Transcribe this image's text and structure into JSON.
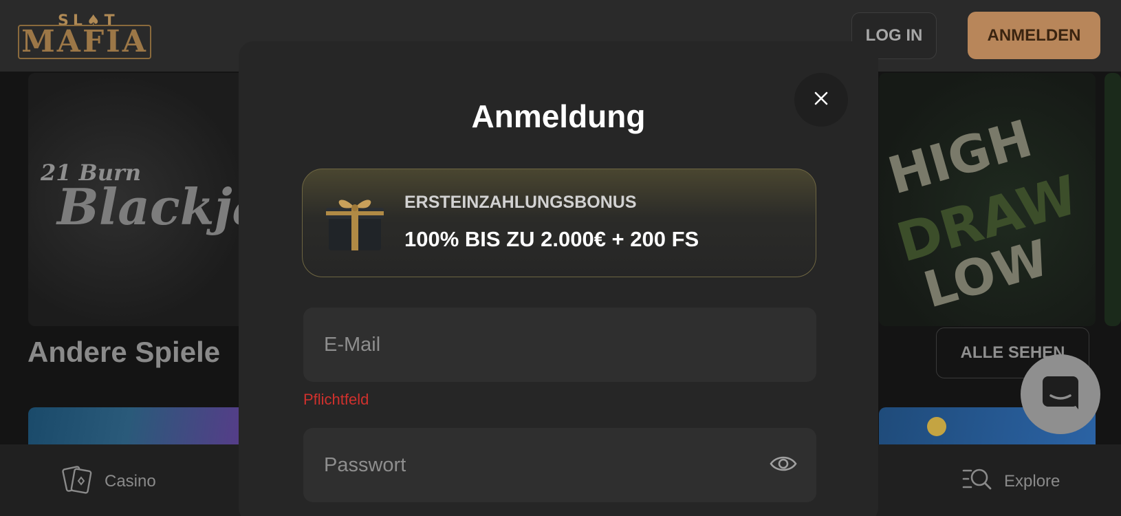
{
  "header": {
    "logo_small": "SL♠T",
    "logo_big": "MAFIA",
    "login_label": "LOG IN",
    "register_label": "ANMELDEN"
  },
  "background": {
    "tile_blackjack_line1": "21 Burn",
    "tile_blackjack_line2": "Blackjack",
    "tile_hilo_word1": "HIGH",
    "tile_hilo_word2": "DRAW",
    "tile_hilo_word3": "LOW",
    "section_title": "Andere Spiele",
    "see_all_label": "ALLE SEHEN"
  },
  "bottom_nav": {
    "casino_label": "Casino",
    "explore_label": "Explore"
  },
  "modal": {
    "title": "Anmeldung",
    "bonus": {
      "label": "ERSTEINZAHLUNGSBONUS",
      "value": "100% BIS ZU 2.000€ + 200 FS"
    },
    "email": {
      "placeholder": "E-Mail",
      "value": "",
      "error": "Pflichtfeld"
    },
    "password": {
      "placeholder": "Passwort",
      "value": ""
    }
  },
  "icons": {
    "close": "close-icon",
    "eye": "eye-icon",
    "gift": "gift-icon",
    "casino": "cards-icon",
    "explore": "search-list-icon",
    "chat": "chat-icon"
  },
  "colors": {
    "accent": "#b8865a",
    "error": "#d0312d",
    "modal_bg": "#262626",
    "input_bg": "#2f2f2f"
  }
}
